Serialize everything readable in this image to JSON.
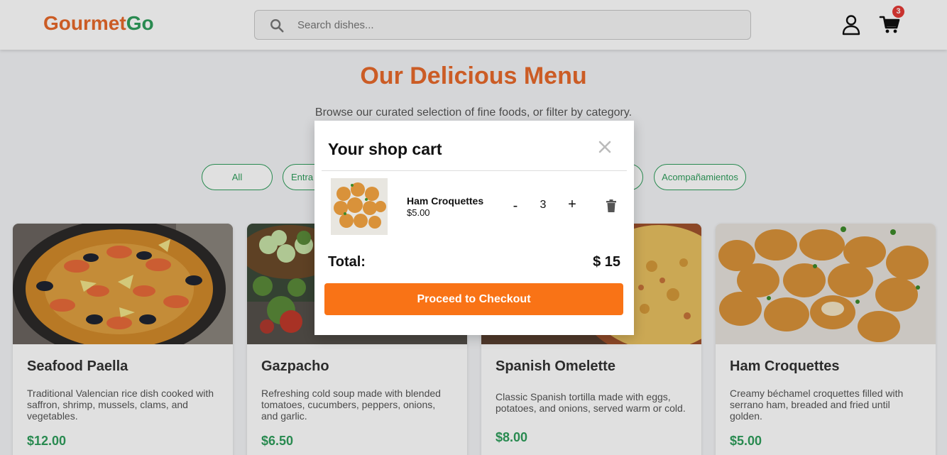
{
  "header": {
    "logo_part1": "Gourmet",
    "logo_part2": "Go",
    "search_placeholder": "Search dishes...",
    "cart_count": "3"
  },
  "hero": {
    "title": "Our Delicious Menu",
    "subtitle": "Browse our curated selection of fine foods, or filter by category."
  },
  "categories": [
    {
      "label": "All"
    },
    {
      "label": "Entra"
    },
    {
      "label": ""
    },
    {
      "label": "Acompañamientos"
    }
  ],
  "products": [
    {
      "name": "Seafood Paella",
      "description": "Traditional Valencian rice dish cooked with saffron, shrimp, mussels, clams, and vegetables.",
      "price": "$12.00"
    },
    {
      "name": "Gazpacho",
      "description": "Refreshing cold soup made with blended tomatoes, cucumbers, peppers, onions, and garlic.",
      "price": "$6.50"
    },
    {
      "name": "Spanish Omelette",
      "description": "Classic Spanish tortilla made with eggs, potatoes, and onions, served warm or cold.",
      "price": "$8.00"
    },
    {
      "name": "Ham Croquettes",
      "description": "Creamy béchamel croquettes filled with serrano ham, breaded and fried until golden.",
      "price": "$5.00"
    }
  ],
  "cart": {
    "title": "Your shop cart",
    "items": [
      {
        "name": "Ham Croquettes",
        "price": "$5.00",
        "quantity": "3"
      }
    ],
    "minus_label": "-",
    "plus_label": "+",
    "total_label": "Total:",
    "total_value": "$ 15",
    "checkout_label": "Proceed to Checkout"
  },
  "colors": {
    "brand_orange": "#e8692b",
    "brand_green": "#2f9e5c",
    "checkout_orange": "#f97316",
    "badge_red": "#e53935"
  }
}
